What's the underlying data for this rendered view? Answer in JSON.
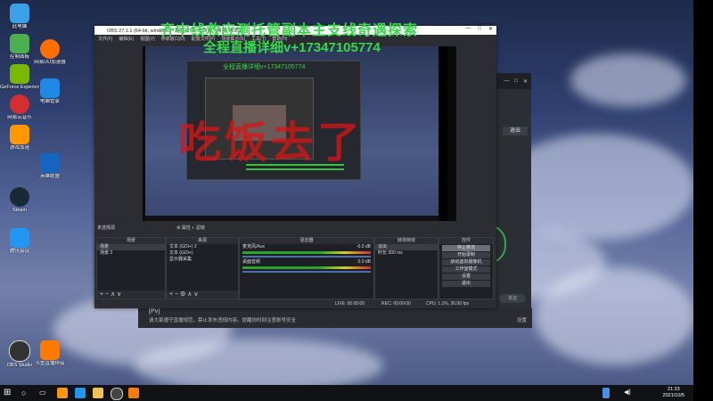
{
  "desktop_icons": [
    {
      "label": "此电脑",
      "color": "#3aa0e8"
    },
    {
      "label": "控制面板",
      "color": "#4caf50"
    },
    {
      "label": "GeForce Experience",
      "color": "#76b900"
    },
    {
      "label": "网易云音乐",
      "color": "#d32f2f"
    },
    {
      "label": "电脑管家",
      "color": "#1e88e5"
    },
    {
      "label": "网易UU加速器",
      "color": "#ff6f00"
    },
    {
      "label": "游戏加速",
      "color": "#ff9800"
    },
    {
      "label": "Steam",
      "color": "#1b2838"
    },
    {
      "label": "腾讯会议",
      "color": "#2196f3"
    },
    {
      "label": "英雄联盟",
      "color": "#1565c0"
    },
    {
      "label": "OBS Studio",
      "color": "#333333"
    },
    {
      "label": "斗鱼直播伴侣",
      "color": "#ff7a00"
    }
  ],
  "overlay": {
    "line1": "齐中线救应测托管副本主支线奇遇探索",
    "line2": "全程直播详细v+17347105774",
    "watermark": "吃饭去了"
  },
  "obs": {
    "title": "OBS 27.1.1 (64-bit, windows) - 配置文件: 未命名 - 场景: 未命名",
    "menu": [
      "文件(F)",
      "编辑(E)",
      "视图(V)",
      "停靠窗口(D)",
      "配置文件(P)",
      "场景集合(S)",
      "工具(T)",
      "帮助(H)"
    ],
    "nested_text": "全程直播详细v+17347105774",
    "no_source_label": "未选择源",
    "props_label": "属性",
    "filters_label": "滤镜",
    "scenes": {
      "header": "场景",
      "items": [
        "场景",
        "场景 2"
      ]
    },
    "sources": {
      "header": "来源",
      "items": [
        "文本 (GDI+) 2",
        "文本 (GDI+)",
        "显示器采集"
      ]
    },
    "mixer": {
      "header": "混音器",
      "channels": [
        {
          "name": "麦克风/Aux",
          "db": "-0.0 dB"
        },
        {
          "name": "桌面音频",
          "db": "0.0 dB"
        }
      ]
    },
    "transitions": {
      "header": "转场特效",
      "type": "淡出",
      "duration_label": "时长",
      "duration": "300 ms"
    },
    "controls": {
      "header": "控件",
      "buttons": [
        "停止推流",
        "开始录制",
        "启动虚拟摄像机",
        "工作室模式",
        "设置",
        "退出"
      ],
      "active_index": 0
    },
    "status": {
      "live": "LIVE: 00:00:00",
      "rec": "REC: 00:00:00",
      "cpu": "CPU: 1.1%, 30.00 fps"
    }
  },
  "bg_app": {
    "exit_label": "退出",
    "send_label": "发送",
    "preview_label": "[Pv]",
    "message": "请大家遵守直播规范，禁止发布违规内容。提醒你时刻注意账号安全",
    "right_text": "设置"
  },
  "taskbar": {
    "time": "21:33",
    "date": "2021/10/5"
  }
}
